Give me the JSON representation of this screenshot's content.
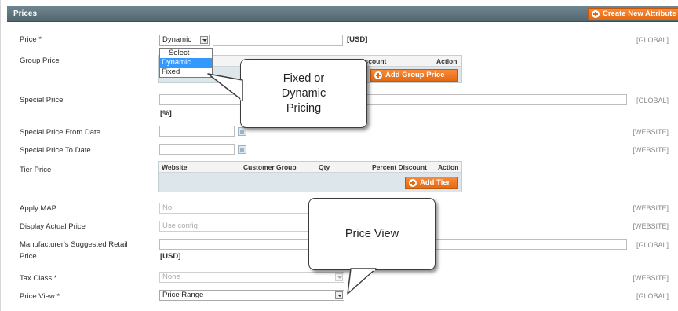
{
  "header": {
    "title": "Prices",
    "create_button": "Create New Attribute"
  },
  "fields": {
    "price": {
      "label": "Price *",
      "select_value": "Dynamic",
      "currency": "[USD]",
      "scope": "[GLOBAL]"
    },
    "group_price": {
      "label": "Group Price",
      "headers": {
        "discount": "Discount",
        "action": "Action"
      },
      "add_button": "Add Group Price"
    },
    "special_price": {
      "label": "Special Price",
      "unit": "[%]",
      "scope": "[GLOBAL]"
    },
    "special_from": {
      "label": "Special Price From Date",
      "scope": "[WEBSITE]"
    },
    "special_to": {
      "label": "Special Price To Date",
      "scope": "[WEBSITE]"
    },
    "tier_price": {
      "label": "Tier Price",
      "headers": {
        "website": "Website",
        "customer_group": "Customer Group",
        "qty": "Qty",
        "percent_discount": "Percent Discount",
        "action": "Action"
      },
      "add_button": "Add Tier"
    },
    "apply_map": {
      "label": "Apply MAP",
      "value": "No",
      "scope": "[WEBSITE]"
    },
    "display_actual_price": {
      "label": "Display Actual Price",
      "value": "Use config",
      "scope": "[WEBSITE]"
    },
    "msrp": {
      "label_line1": "Manufacturer's Suggested Retail",
      "label_line2": "Price",
      "currency": "[USD]",
      "scope": "[GLOBAL]"
    },
    "tax_class": {
      "label": "Tax Class *",
      "value": "None",
      "scope": "[WEBSITE]"
    },
    "price_view": {
      "label": "Price View *",
      "value": "Price Range",
      "scope": "[GLOBAL]"
    }
  },
  "dropdown": {
    "options": [
      "-- Select --",
      "Dynamic",
      "Fixed"
    ],
    "selected_index": 1
  },
  "callouts": {
    "pricing_line1": "Fixed or",
    "pricing_line2": "Dynamic",
    "pricing_line3": "Pricing",
    "price_view": "Price View"
  },
  "icons": [
    "plus-circle-icon",
    "calendar-icon",
    "chevron-down-icon"
  ],
  "colors": {
    "header_bg": "#5f757f",
    "accent_orange": "#eb6f1b",
    "grid_bg": "#dde6ea",
    "dropdown_highlight": "#3399ff"
  }
}
